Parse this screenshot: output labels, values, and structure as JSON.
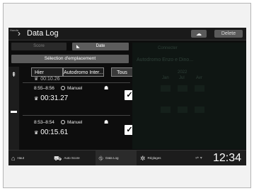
{
  "header": {
    "brand": "Honda",
    "title": "Data Log",
    "delete_label": "Delete"
  },
  "sort_tabs": {
    "score_label": "Score",
    "date_label": "Date"
  },
  "location_button": "Sélection d'emplacement",
  "filters": {
    "day": "Hier",
    "track": "Autodromo Inter...",
    "all": "Tous"
  },
  "entries": [
    {
      "time_range": "",
      "mode": "",
      "duration": "00:10.26",
      "checked": false
    },
    {
      "time_range": "8:55–8:56",
      "mode": "Manuel",
      "duration": "00:31.27",
      "checked": true
    },
    {
      "time_range": "8:53–8:54",
      "mode": "Manuel",
      "duration": "00:15.61",
      "checked": true
    }
  ],
  "right_panel_ghost": {
    "l1": "Connecter",
    "l2": "Autodromo Enzo e Dino...",
    "l3": "2022",
    "cols": [
      "Jan",
      "Jul",
      "Avr"
    ]
  },
  "bottom_nav": [
    {
      "label": "Haut",
      "icon": "home-icon"
    },
    {
      "label": "Auto Score",
      "icon": "car-icon"
    },
    {
      "label": "Data Log",
      "icon": "data-log-icon"
    },
    {
      "label": "Réglages",
      "icon": "gear-icon"
    }
  ],
  "clock": "12:34",
  "colors": {
    "screen_bg": "#0d0d0d",
    "button_gray": "#5c5c5c",
    "text": "#ffffff"
  }
}
